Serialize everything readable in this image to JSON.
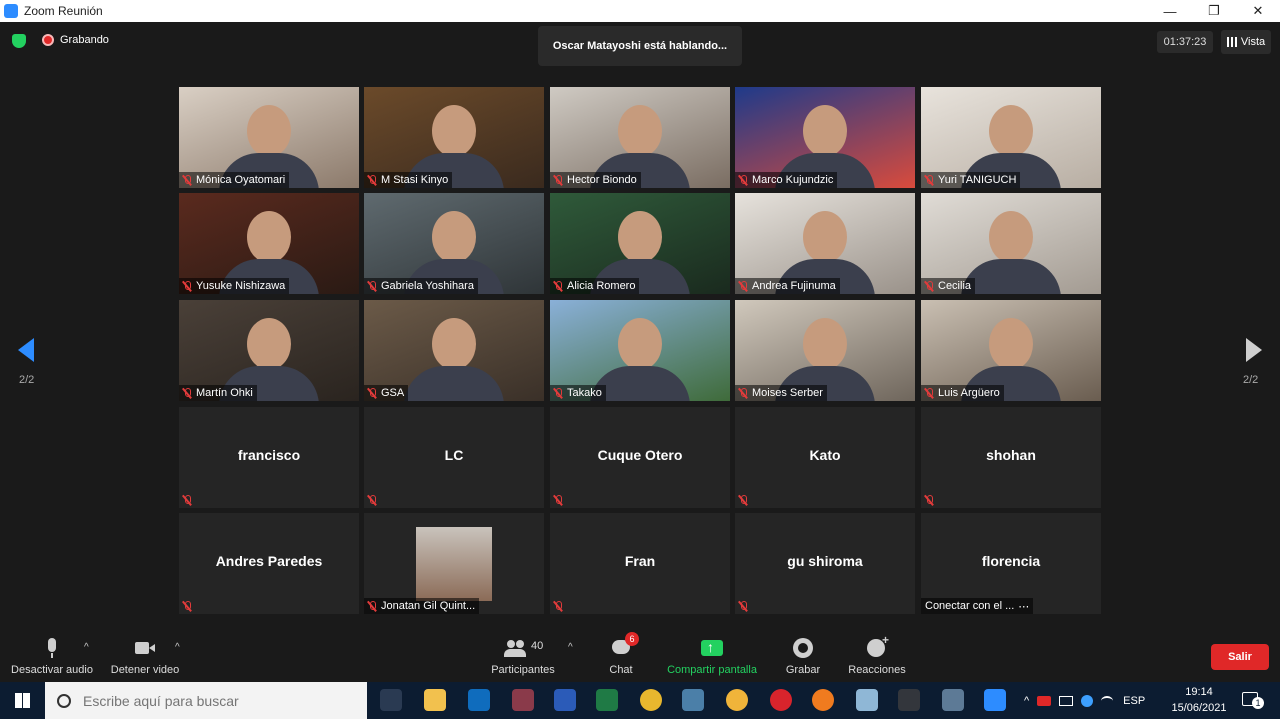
{
  "window": {
    "title": "Zoom Reunión",
    "minimize": "—",
    "restore": "❐",
    "close": "✕"
  },
  "recording": {
    "label": "Grabando"
  },
  "speaker": {
    "text": "Oscar Matayoshi está hablando..."
  },
  "timer": "01:37:23",
  "view_label": "Vista",
  "pager": {
    "left": "2/2",
    "right": "2/2"
  },
  "video_tiles": [
    {
      "name": "Mónica Oyatomari",
      "muted": true
    },
    {
      "name": "M Stasi Kinyo",
      "muted": true
    },
    {
      "name": "Hector Biondo",
      "muted": true
    },
    {
      "name": "Marco Kujundzic",
      "muted": true
    },
    {
      "name": "Yuri TANIGUCH",
      "muted": true
    },
    {
      "name": "Yusuke Nishizawa",
      "muted": true
    },
    {
      "name": "Gabriela Yoshihara",
      "muted": true
    },
    {
      "name": "Alicia Romero",
      "muted": true
    },
    {
      "name": "Andrea Fujinuma",
      "muted": true
    },
    {
      "name": "Cecilia",
      "muted": true
    },
    {
      "name": "Martín Ohki",
      "muted": true
    },
    {
      "name": "GSA",
      "muted": true
    },
    {
      "name": "Takako",
      "muted": true
    },
    {
      "name": "Moises Serber",
      "muted": true
    },
    {
      "name": "Luis Argüero",
      "muted": true
    }
  ],
  "name_tiles": [
    {
      "name": "francisco"
    },
    {
      "name": "LC"
    },
    {
      "name": "Cuque Otero"
    },
    {
      "name": "Kato"
    },
    {
      "name": "shohan"
    },
    {
      "name": "Andres Paredes"
    },
    {
      "name": "Jonatan Gil Quint..."
    },
    {
      "name": "Fran"
    },
    {
      "name": "gu shiroma"
    },
    {
      "name": "florencia",
      "status": "Conectar con el ...",
      "status_extra": "⋯"
    }
  ],
  "toolbar": {
    "audio_label": "Desactivar audio",
    "video_label": "Detener video",
    "participants_label": "Participantes",
    "participants_count": "40",
    "chat_label": "Chat",
    "chat_badge": "6",
    "share_label": "Compartir pantalla",
    "record_label": "Grabar",
    "reactions_label": "Reacciones",
    "leave_label": "Salir",
    "caret": "^"
  },
  "taskbar": {
    "search_placeholder": "Escribe aquí para buscar",
    "lang": "ESP",
    "time": "19:14",
    "date": "15/06/2021",
    "notif_count": "1"
  },
  "colors": {
    "accent": "#2d8cff",
    "leave": "#e02828",
    "share": "#23d160",
    "mute": "#e23b3b"
  }
}
